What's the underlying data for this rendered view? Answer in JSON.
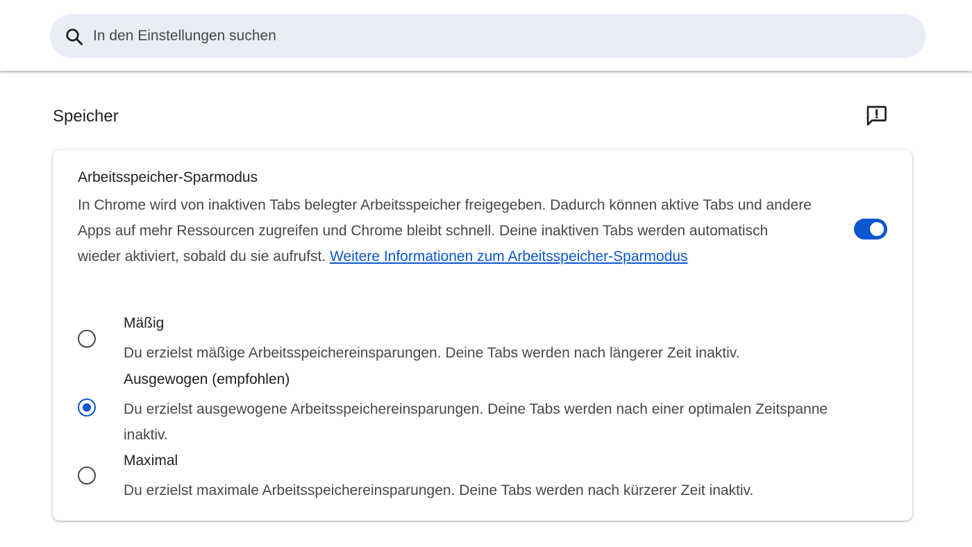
{
  "search": {
    "placeholder": "In den Einstellungen suchen",
    "icon": "search-icon"
  },
  "section": {
    "title": "Speicher",
    "feedback_icon": "feedback-icon"
  },
  "memory_saver": {
    "title": "Arbeitsspeicher-Sparmodus",
    "description": "In Chrome wird von inaktiven Tabs belegter Arbeitsspeicher freigegeben. Dadurch können aktive Tabs und andere Apps auf mehr Ressourcen zugreifen und Chrome bleibt schnell. Deine inaktiven Tabs werden automatisch wieder aktiviert, sobald du sie aufrufst.",
    "link": "Weitere Informationen zum Arbeitsspeicher-Sparmodus",
    "enabled": true,
    "options": [
      {
        "label": "Mäßig",
        "description": "Du erzielst mäßige Arbeitsspeichereinsparungen. Deine Tabs werden nach längerer Zeit inaktiv.",
        "selected": false
      },
      {
        "label": "Ausgewogen (empfohlen)",
        "description": "Du erzielst ausgewogene Arbeitsspeichereinsparungen. Deine Tabs werden nach einer optimalen Zeitspanne inaktiv.",
        "selected": true
      },
      {
        "label": "Maximal",
        "description": "Du erzielst maximale Arbeitsspeichereinsparungen. Deine Tabs werden nach kürzerer Zeit inaktiv.",
        "selected": false
      }
    ]
  },
  "colors": {
    "accent": "#0b57d0",
    "search_bg": "#e9eef6",
    "text_primary": "#1f1f1f",
    "text_secondary": "#474747"
  }
}
